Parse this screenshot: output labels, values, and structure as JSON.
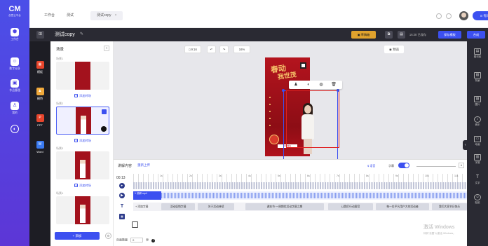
{
  "brand": {
    "logo": "CM",
    "name": "创意云平台"
  },
  "rail": [
    {
      "label": "工作台",
      "icon": "desktop-icon"
    },
    {
      "label": "数字分身",
      "icon": "person-icon"
    },
    {
      "label": "作品管理",
      "icon": "folder-icon"
    },
    {
      "label": "我的",
      "icon": "user-icon"
    }
  ],
  "topbar": {
    "tabs": [
      {
        "label": "工作台"
      },
      {
        "label": "测试"
      },
      {
        "label": "测试copy",
        "close": "×"
      }
    ],
    "pill": "⊙ 有问"
  },
  "header": {
    "grid_icon": "⊞",
    "title": "测试copy",
    "edit_icon": "✎",
    "draft_label": "草稿箱",
    "save_status": "16:28 已保存",
    "save_template": "保存模板",
    "compose": "合成"
  },
  "tools": [
    {
      "label": "模板",
      "color": "#e8452c"
    },
    {
      "label": "模特",
      "color": "#f0a93b"
    },
    {
      "label": "PPT",
      "color": "#e8452c"
    },
    {
      "label": "Word",
      "color": "#3a7af0"
    }
  ],
  "scenes": {
    "title": "场景",
    "items": [
      {
        "num": "场景1",
        "add": "添加转场"
      },
      {
        "num": "场景2",
        "add": "添加转场"
      },
      {
        "num": "场景3",
        "add": "添加转场"
      },
      {
        "num": "场景4",
        "add": ""
      }
    ],
    "add_button": "+ 添加"
  },
  "canvas": {
    "ratio": "9:16",
    "undo": "↶",
    "redo": "↷",
    "zoom": "16%",
    "preview": "◉ 预览",
    "poster_title_1": "春动",
    "poster_title_2": "我世茂",
    "poster_button": "立即参加",
    "floatbar": [
      "♟",
      "◐",
      "◍",
      "🗑"
    ]
  },
  "right_tools": [
    {
      "label": "素材库"
    },
    {
      "label": "背景"
    },
    {
      "label": "图片"
    },
    {
      "label": "音乐"
    },
    {
      "label": "动画"
    },
    {
      "label": "字幕"
    },
    {
      "label": "文字"
    },
    {
      "label": "贴纸"
    }
  ],
  "timeline": {
    "title": "讲解内容",
    "tag": "重新上传",
    "lang": "$ 语音",
    "caption_toggle": "字幕",
    "current_time": "00:13",
    "ruler": [
      "1s",
      "2s",
      "3s",
      "4s",
      "5s",
      "6s",
      "7s",
      "8s",
      "9s",
      "10s",
      "11s"
    ],
    "clip_label": "1 讲解.mp4",
    "add_effect": "+ 添加字幕",
    "segments": [
      "活动促销字幕",
      "关于活动持续",
      "邀在节·一周期优活动字幕之期",
      "让我们行动客官",
      "每一位平凡用户大的活动者",
      "我们大家节日快乐"
    ],
    "page_label": "页面数量",
    "page_value": "0",
    "page_unit": "秒"
  },
  "watermark": {
    "title": "激活 Windows",
    "sub": "转到\"设置\"以激活 Windows。"
  }
}
